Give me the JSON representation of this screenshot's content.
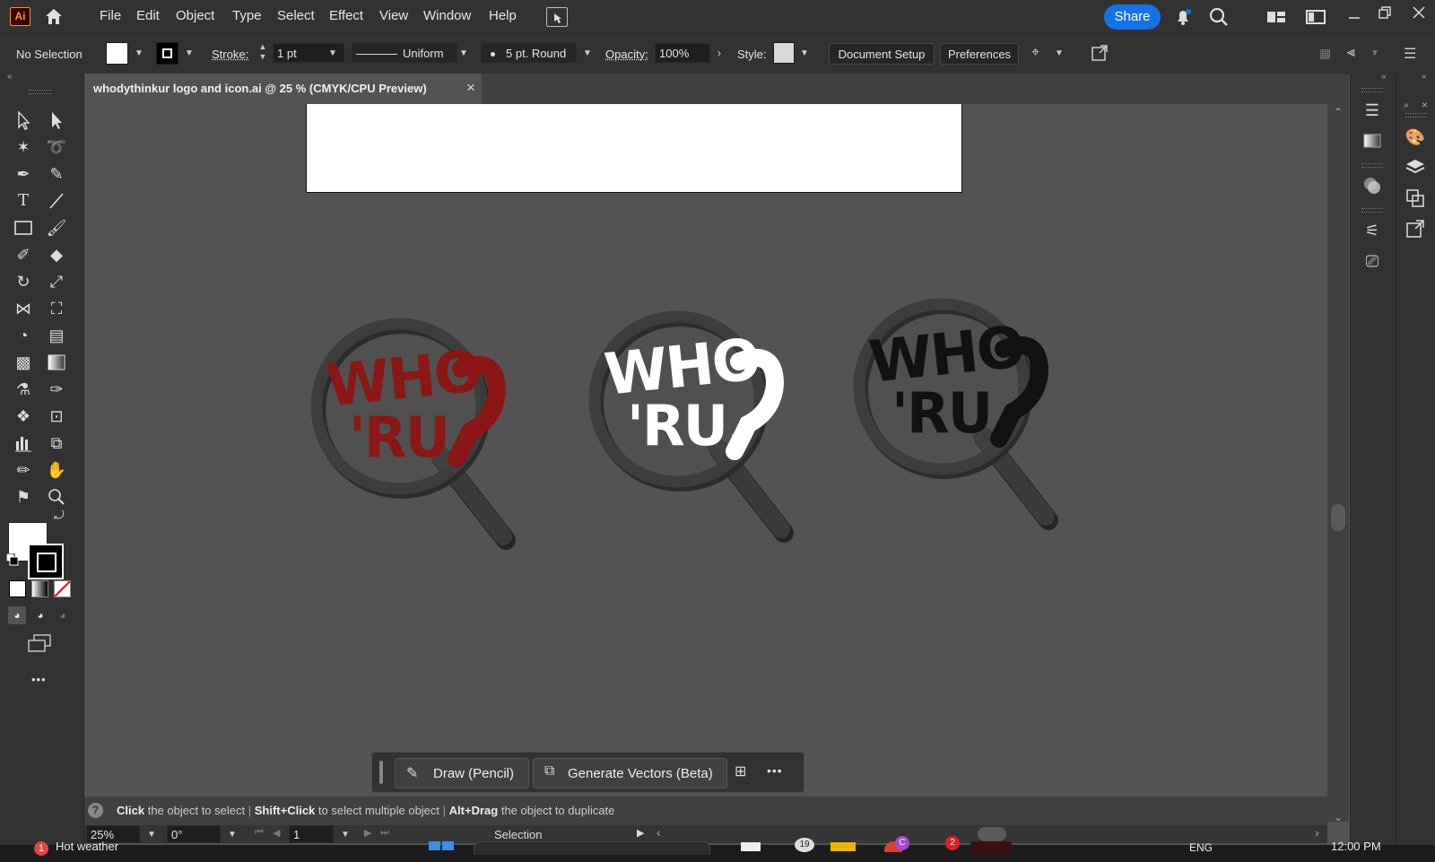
{
  "menubar": {
    "items": [
      "File",
      "Edit",
      "Object",
      "Type",
      "Select",
      "Effect",
      "View",
      "Window",
      "Help"
    ],
    "app_logo": "Ai",
    "share_label": "Share"
  },
  "controlbar": {
    "selection": "No Selection",
    "stroke_label": "Stroke:",
    "stroke_value": "1 pt",
    "profile_label": "Uniform",
    "brush_label": "5 pt. Round",
    "opacity_label": "Opacity:",
    "opacity_value": "100%",
    "style_label": "Style:",
    "document_setup": "Document Setup",
    "preferences": "Preferences"
  },
  "tab": {
    "title": "whodythinkur logo and icon.ai @ 25 % (CMYK/CPU Preview)",
    "close": "×"
  },
  "canvas": {
    "logos": [
      {
        "line1": "WHO",
        "line2": "'RU.",
        "color": "#8a1616"
      },
      {
        "line1": "WHO",
        "line2": "'RU.",
        "color": "#ffffff"
      },
      {
        "line1": "WHO",
        "line2": "'RU.",
        "color": "#111111"
      }
    ]
  },
  "contextbar": {
    "draw_label": "Draw (Pencil)",
    "generate_label": "Generate Vectors (Beta)",
    "more": "•••"
  },
  "statusbar": {
    "hint_click": "Click",
    "hint_click_rest": "the object to select",
    "hint_shift": "Shift+Click",
    "hint_shift_rest": "to select multiple object",
    "hint_alt": "Alt+Drag",
    "hint_alt_rest": "the object to duplicate",
    "zoom": "25%",
    "rotation": "0°",
    "artboard": "1",
    "mode": "Selection",
    "help": "?"
  },
  "taskbar": {
    "weather_badge": "1",
    "weather_text": "Hot weather",
    "lang": "ENG",
    "time": "12:00 PM",
    "badge_19": "19",
    "badge_c": "C",
    "badge_2": "2"
  },
  "toolbar": {
    "more": "•••"
  }
}
